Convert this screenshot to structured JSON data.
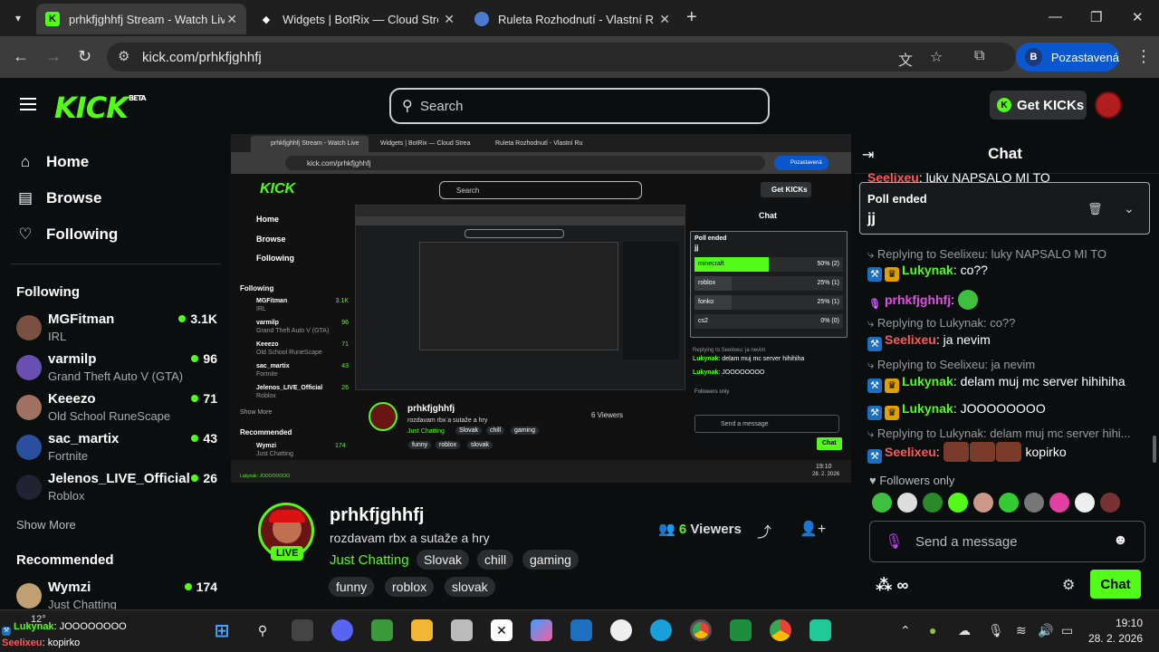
{
  "browser": {
    "tabs": [
      {
        "title": "prhkfjghhfj Stream - Watch Live",
        "active": true
      },
      {
        "title": "Widgets | BotRix — Cloud Stream",
        "active": false
      },
      {
        "title": "Ruleta Rozhodnutí - Vlastní Ruleta",
        "active": false
      }
    ],
    "url": "kick.com/prhkfjghhfj",
    "profile_initial": "B",
    "profile_label": "Pozastavená"
  },
  "header": {
    "logo": "KICK",
    "logo_beta": "BETA",
    "search_placeholder": "Search",
    "get_kicks": "Get KICKs"
  },
  "sidebar": {
    "nav": [
      {
        "label": "Home",
        "icon": "home-icon"
      },
      {
        "label": "Browse",
        "icon": "browse-icon"
      },
      {
        "label": "Following",
        "icon": "heart-icon"
      }
    ],
    "following_title": "Following",
    "following": [
      {
        "name": "MGFitman",
        "category": "IRL",
        "viewers": "3.1K",
        "color": "#7a5040"
      },
      {
        "name": "varmilp",
        "category": "Grand Theft Auto V (GTA)",
        "viewers": "96",
        "color": "#6a4fb3"
      },
      {
        "name": "Keeezo",
        "category": "Old School RuneScape",
        "viewers": "71",
        "color": "#a07060"
      },
      {
        "name": "sac_martix",
        "category": "Fortnite",
        "viewers": "43",
        "color": "#2a4fa0"
      },
      {
        "name": "Jelenos_LIVE_Official",
        "category": "Roblox",
        "viewers": "26",
        "color": "#334"
      }
    ],
    "show_more": "Show More",
    "recommended_title": "Recommended",
    "recommended": [
      {
        "name": "Wymzi",
        "category": "Just Chatting",
        "viewers": "174",
        "color": "#c0a070"
      }
    ]
  },
  "stream": {
    "name": "prhkfjghhfj",
    "title": "rozdavam rbx a sutaže a hry",
    "category": "Just Chatting",
    "tags": [
      "Slovak",
      "chill",
      "gaming",
      "funny",
      "roblox",
      "slovak"
    ],
    "viewers_count": "6",
    "viewers_label": "Viewers",
    "live": "LIVE"
  },
  "nested": {
    "tabs": [
      "prhkfjghhfj Stream - Watch Live",
      "Widgets | BotRix — Cloud Strea",
      "Ruleta Rozhodnutí - Vlastní Ru"
    ],
    "url": "kick.com/prhkfjghhfj",
    "profile": "Pozastavená",
    "search": "Search",
    "get_kicks": "Get KICKs",
    "nav": [
      "Home",
      "Browse",
      "Following"
    ],
    "following_title": "Following",
    "following": [
      {
        "name": "MGFitman",
        "cat": "IRL",
        "v": "3.1K"
      },
      {
        "name": "varmilp",
        "cat": "Grand Theft Auto V (GTA)",
        "v": "96"
      },
      {
        "name": "Keeezo",
        "cat": "Old School RuneScape",
        "v": "71"
      },
      {
        "name": "sac_martix",
        "cat": "Fortnite",
        "v": "43"
      },
      {
        "name": "Jelenos_LIVE_Official",
        "cat": "Roblox",
        "v": "26"
      }
    ],
    "show_more": "Show More",
    "recommended": "Recommended",
    "rec_name": "Wymzi",
    "rec_cat": "Just Chatting",
    "rec_v": "174",
    "chat_title": "Chat",
    "poll_label": "Poll ended",
    "poll_q": "jj",
    "poll_options": [
      {
        "label": "minecraft",
        "result": "50% (2)",
        "pct": 50
      },
      {
        "label": "roblox",
        "result": "25% (1)",
        "pct": 25
      },
      {
        "label": "fonko",
        "result": "25% (1)",
        "pct": 25
      },
      {
        "label": "cs2",
        "result": "0% (0)",
        "pct": 0
      }
    ],
    "chat_lines": [
      {
        "reply": "Replying to Seelixeu: ja nevim"
      },
      {
        "user": "Lukynak",
        "text": ": delam muj mc server hihihiha"
      },
      {
        "user": "Lukynak",
        "text": ": JOOOOOOOO"
      }
    ],
    "followers_only": "Followers only",
    "send": "Send a message",
    "chat_btn": "Chat",
    "stream_name": "prhkfjghhfj",
    "stream_title": "rozdavam rbx a sutaže a hry",
    "viewers": "6 Viewers",
    "tags": [
      "Just Chatting",
      "Slovak",
      "chill",
      "gaming",
      "funny",
      "roblox",
      "slovak"
    ],
    "time": "19:10",
    "date": "28. 2. 2026",
    "overlay": "Lukynak: JOOOOOOOO"
  },
  "chat": {
    "title": "Chat",
    "top_partial": {
      "user": "Seelixeu",
      "text": ": luky NAPSALO MI TO"
    },
    "poll": {
      "label": "Poll ended",
      "question": "jj"
    },
    "messages": [
      {
        "type": "reply",
        "text": "Replying to Seelixeu: luky NAPSALO MI TO"
      },
      {
        "type": "msg",
        "user": "Lukynak",
        "text": ": co??",
        "badges": [
          "mod",
          "vip"
        ]
      },
      {
        "type": "msg",
        "user": "prhkfjghhfj",
        "text": ":",
        "badges": [
          "host"
        ]
      },
      {
        "type": "reply",
        "text": "Replying to Lukynak: co??"
      },
      {
        "type": "msg",
        "user": "Seelixeu",
        "text": ": ja nevim",
        "badges": [
          "mod"
        ]
      },
      {
        "type": "reply",
        "text": "Replying to Seelixeu: ja nevim"
      },
      {
        "type": "msg",
        "user": "Lukynak",
        "text": ": delam muj mc server hihihiha",
        "badges": [
          "mod",
          "vip"
        ]
      },
      {
        "type": "msg",
        "user": "Lukynak",
        "text": ": JOOOOOOOO",
        "badges": [
          "mod",
          "vip"
        ]
      },
      {
        "type": "reply",
        "text": "Replying to Lukynak: delam muj mc server hihi..."
      },
      {
        "type": "msg",
        "user": "Seelixeu",
        "text": "kopirko",
        "badges": [
          "mod"
        ]
      }
    ],
    "followers_only": "Followers only",
    "message_placeholder": "Send a message",
    "points": "∞",
    "send_button": "Chat"
  },
  "taskbar": {
    "weather": "12°",
    "overlay_line1": {
      "user": "Lukynak",
      "text": ": JOOOOOOOO"
    },
    "overlay_line2": {
      "user": "Seelixeu",
      "text": ": kopirko"
    },
    "time": "19:10",
    "date": "28. 2. 2026"
  }
}
